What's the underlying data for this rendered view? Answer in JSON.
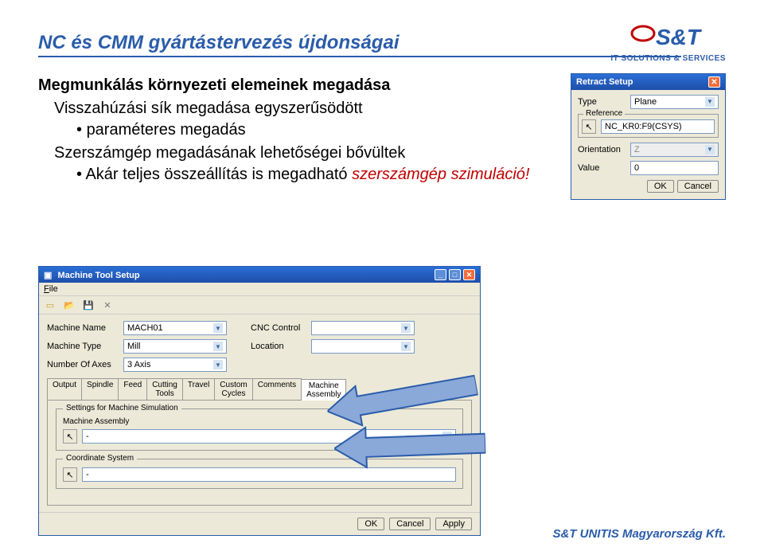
{
  "header": {
    "title": "NC és CMM gyártástervezés újdonságai",
    "logo_tag": "IT SOLUTIONS & SERVICES"
  },
  "content": {
    "subheading": "Megmunkálás környezeti elemeinek megadása",
    "line1": "Visszahúzási sík megadása egyszerűsödött",
    "bullet1": "paraméteres megadás",
    "line2": "Szerszámgép megadásának lehetőségei bővültek",
    "bullet2_a": "Akár teljes összeállítás is megadható ",
    "bullet2_b": "szerszámgép szimuláció!"
  },
  "footer": "S&T UNITIS Magyarország Kft.",
  "retract": {
    "title": "Retract Setup",
    "type_label": "Type",
    "type_value": "Plane",
    "reference_label": "Reference",
    "reference_value": "NC_KR0:F9(CSYS)",
    "orientation_label": "Orientation",
    "orientation_value": "Z",
    "value_label": "Value",
    "value_value": "0",
    "ok": "OK",
    "cancel": "Cancel"
  },
  "mt": {
    "title": "Machine Tool Setup",
    "menu_file": "File",
    "name_label": "Machine Name",
    "name_value": "MACH01",
    "type_label": "Machine Type",
    "type_value": "Mill",
    "axes_label": "Number Of Axes",
    "axes_value": "3 Axis",
    "cnc_label": "CNC Control",
    "cnc_value": "",
    "loc_label": "Location",
    "loc_value": "",
    "tabs": [
      "Output",
      "Spindle",
      "Feed",
      "Cutting\nTools",
      "Travel",
      "Custom\nCycles",
      "Comments",
      "Machine\nAssembly"
    ],
    "group1": "Settings for Machine Simulation",
    "group1_sub": "Machine Assembly",
    "group1_val": "-",
    "group2": "Coordinate System",
    "group2_val": "-",
    "ok": "OK",
    "cancel": "Cancel",
    "apply": "Apply"
  }
}
